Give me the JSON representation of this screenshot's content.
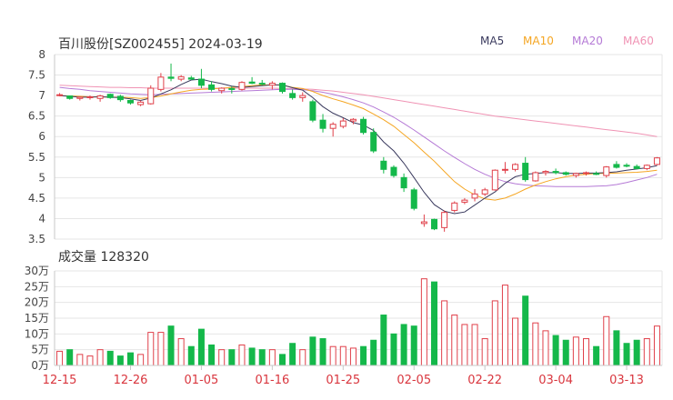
{
  "header": {
    "title": "百川股份[SZ002455] 2024-03-19",
    "volume_label": "成交量",
    "volume_value": "128320"
  },
  "legend": [
    {
      "name": "MA5",
      "color": "#3a3a5e"
    },
    {
      "name": "MA10",
      "color": "#f5a623"
    },
    {
      "name": "MA20",
      "color": "#b57ad6"
    },
    {
      "name": "MA60",
      "color": "#f093b4"
    }
  ],
  "colors": {
    "up": "#e0404a",
    "down": "#14b84a",
    "grid": "#e6e6e6",
    "axis": "#c8c8c8"
  },
  "chart_data": [
    {
      "type": "candlestick",
      "title": "百川股份[SZ002455] 2024-03-19",
      "ylim": [
        3.5,
        8
      ],
      "y_ticks": [
        3.5,
        4,
        4.5,
        5,
        5.5,
        6,
        6.5,
        7,
        7.5,
        8
      ],
      "x_tick_labels": [
        "12-15",
        "12-26",
        "01-05",
        "01-16",
        "01-25",
        "02-05",
        "02-22",
        "03-04",
        "03-13"
      ],
      "x_tick_index": [
        0,
        7,
        14,
        21,
        28,
        35,
        42,
        49,
        56
      ],
      "ohlc": [
        [
          7.0,
          7.06,
          6.98,
          7.02
        ],
        [
          6.99,
          7.0,
          6.9,
          6.93
        ],
        [
          6.93,
          6.98,
          6.88,
          6.96
        ],
        [
          6.95,
          7.0,
          6.9,
          6.97
        ],
        [
          6.93,
          7.02,
          6.85,
          6.99
        ],
        [
          7.03,
          7.05,
          6.92,
          6.95
        ],
        [
          6.98,
          7.02,
          6.85,
          6.9
        ],
        [
          6.88,
          6.9,
          6.78,
          6.82
        ],
        [
          6.78,
          6.88,
          6.74,
          6.84
        ],
        [
          6.8,
          7.25,
          6.78,
          7.18
        ],
        [
          7.15,
          7.55,
          7.1,
          7.45
        ],
        [
          7.45,
          7.78,
          7.35,
          7.42
        ],
        [
          7.4,
          7.5,
          7.35,
          7.46
        ],
        [
          7.43,
          7.48,
          7.38,
          7.4
        ],
        [
          7.4,
          7.65,
          7.18,
          7.25
        ],
        [
          7.26,
          7.35,
          7.1,
          7.15
        ],
        [
          7.12,
          7.2,
          7.05,
          7.18
        ],
        [
          7.17,
          7.22,
          7.05,
          7.15
        ],
        [
          7.15,
          7.35,
          7.12,
          7.32
        ],
        [
          7.33,
          7.45,
          7.28,
          7.3
        ],
        [
          7.3,
          7.38,
          7.25,
          7.28
        ],
        [
          7.25,
          7.35,
          7.15,
          7.3
        ],
        [
          7.3,
          7.32,
          7.05,
          7.1
        ],
        [
          7.05,
          7.15,
          6.9,
          6.95
        ],
        [
          6.95,
          7.08,
          6.85,
          7.0
        ],
        [
          6.85,
          6.9,
          6.35,
          6.4
        ],
        [
          6.4,
          6.55,
          6.1,
          6.2
        ],
        [
          6.2,
          6.35,
          6.0,
          6.3
        ],
        [
          6.25,
          6.45,
          6.2,
          6.38
        ],
        [
          6.38,
          6.45,
          6.3,
          6.42
        ],
        [
          6.42,
          6.48,
          6.05,
          6.1
        ],
        [
          6.1,
          6.2,
          5.6,
          5.65
        ],
        [
          5.4,
          5.5,
          5.1,
          5.2
        ],
        [
          5.25,
          5.3,
          5.0,
          5.05
        ],
        [
          5.0,
          5.1,
          4.65,
          4.75
        ],
        [
          4.7,
          4.75,
          4.2,
          4.25
        ],
        [
          3.88,
          4.1,
          3.8,
          3.92
        ],
        [
          3.98,
          4.0,
          3.72,
          3.75
        ],
        [
          3.78,
          4.2,
          3.68,
          4.15
        ],
        [
          4.2,
          4.42,
          4.15,
          4.38
        ],
        [
          4.4,
          4.5,
          4.35,
          4.45
        ],
        [
          4.5,
          4.72,
          4.42,
          4.6
        ],
        [
          4.6,
          4.75,
          4.55,
          4.7
        ],
        [
          4.7,
          5.2,
          4.68,
          5.18
        ],
        [
          5.18,
          5.38,
          5.1,
          5.2
        ],
        [
          5.2,
          5.35,
          5.15,
          5.32
        ],
        [
          5.35,
          5.5,
          4.9,
          4.95
        ],
        [
          4.92,
          5.15,
          4.9,
          5.12
        ],
        [
          5.12,
          5.18,
          5.05,
          5.15
        ],
        [
          5.15,
          5.22,
          5.08,
          5.12
        ],
        [
          5.12,
          5.15,
          5.05,
          5.08
        ],
        [
          5.05,
          5.12,
          5.0,
          5.1
        ],
        [
          5.1,
          5.15,
          5.05,
          5.12
        ],
        [
          5.1,
          5.15,
          5.06,
          5.08
        ],
        [
          5.05,
          5.28,
          5.0,
          5.26
        ],
        [
          5.32,
          5.4,
          5.22,
          5.25
        ],
        [
          5.3,
          5.35,
          5.25,
          5.28
        ],
        [
          5.27,
          5.32,
          5.2,
          5.22
        ],
        [
          5.22,
          5.32,
          5.18,
          5.3
        ],
        [
          5.32,
          5.5,
          5.3,
          5.48
        ]
      ],
      "ma": {
        "MA5": [
          7.0,
          6.98,
          6.96,
          6.96,
          6.97,
          6.96,
          6.95,
          6.92,
          6.88,
          6.94,
          7.04,
          7.14,
          7.27,
          7.38,
          7.4,
          7.34,
          7.29,
          7.23,
          7.2,
          7.22,
          7.24,
          7.26,
          7.26,
          7.19,
          7.13,
          6.95,
          6.73,
          6.57,
          6.46,
          6.34,
          6.28,
          6.15,
          5.87,
          5.65,
          5.35,
          5.0,
          4.64,
          4.34,
          4.18,
          4.12,
          4.16,
          4.33,
          4.5,
          4.65,
          4.86,
          5.02,
          5.08,
          5.1,
          5.12,
          5.12,
          5.1,
          5.1,
          5.11,
          5.11,
          5.12,
          5.14,
          5.18,
          5.21,
          5.24,
          5.29
        ],
        "MA10": [
          7.0,
          6.99,
          6.98,
          6.97,
          6.97,
          6.96,
          6.96,
          6.95,
          6.93,
          6.95,
          6.99,
          7.04,
          7.09,
          7.13,
          7.15,
          7.16,
          7.18,
          7.2,
          7.22,
          7.24,
          7.26,
          7.26,
          7.25,
          7.2,
          7.17,
          7.1,
          7.0,
          6.92,
          6.85,
          6.77,
          6.68,
          6.55,
          6.41,
          6.25,
          6.05,
          5.85,
          5.62,
          5.4,
          5.15,
          4.9,
          4.72,
          4.58,
          4.48,
          4.45,
          4.5,
          4.6,
          4.72,
          4.82,
          4.9,
          4.97,
          5.02,
          5.06,
          5.08,
          5.1,
          5.1,
          5.11,
          5.12,
          5.13,
          5.15,
          5.18
        ],
        "MA20": [
          7.2,
          7.17,
          7.15,
          7.12,
          7.1,
          7.08,
          7.06,
          7.04,
          7.03,
          7.02,
          7.03,
          7.04,
          7.05,
          7.06,
          7.07,
          7.08,
          7.09,
          7.1,
          7.11,
          7.12,
          7.13,
          7.14,
          7.15,
          7.15,
          7.14,
          7.12,
          7.08,
          7.03,
          6.97,
          6.9,
          6.82,
          6.72,
          6.6,
          6.47,
          6.32,
          6.16,
          5.99,
          5.82,
          5.65,
          5.49,
          5.34,
          5.2,
          5.08,
          4.98,
          4.9,
          4.85,
          4.82,
          4.8,
          4.79,
          4.78,
          4.78,
          4.78,
          4.78,
          4.79,
          4.8,
          4.83,
          4.88,
          4.94,
          5.0,
          5.08
        ],
        "MA60": [
          7.25,
          7.24,
          7.23,
          7.22,
          7.21,
          7.2,
          7.2,
          7.19,
          7.19,
          7.18,
          7.18,
          7.18,
          7.18,
          7.18,
          7.18,
          7.18,
          7.18,
          7.18,
          7.18,
          7.18,
          7.18,
          7.18,
          7.17,
          7.17,
          7.16,
          7.15,
          7.13,
          7.11,
          7.08,
          7.05,
          7.02,
          6.98,
          6.94,
          6.9,
          6.86,
          6.82,
          6.78,
          6.74,
          6.7,
          6.66,
          6.62,
          6.58,
          6.54,
          6.5,
          6.47,
          6.44,
          6.41,
          6.38,
          6.35,
          6.32,
          6.29,
          6.26,
          6.23,
          6.2,
          6.17,
          6.14,
          6.11,
          6.08,
          6.04,
          6.0
        ]
      }
    },
    {
      "type": "bar",
      "title": "成交量",
      "unit": "万",
      "ylim": [
        0,
        30
      ],
      "y_tick_labels": [
        "0万",
        "5万",
        "10万",
        "15万",
        "20万",
        "25万",
        "30万"
      ],
      "values": [
        4.5,
        5,
        3.5,
        3,
        5,
        4.5,
        3,
        4,
        3.5,
        10.5,
        10.5,
        12.5,
        8.5,
        6,
        11.5,
        6.5,
        5,
        5,
        6.5,
        5.5,
        5,
        5,
        3.5,
        7,
        5,
        9,
        8.5,
        6,
        6,
        5.5,
        6,
        8,
        16,
        10,
        13,
        12.5,
        27.5,
        26.5,
        20.5,
        16,
        13,
        13,
        8.5,
        20.5,
        25.5,
        15,
        22,
        13.5,
        11,
        9.5,
        8,
        9,
        8.5,
        6,
        15.5,
        11,
        7,
        8,
        8.5,
        12.5
      ]
    }
  ]
}
